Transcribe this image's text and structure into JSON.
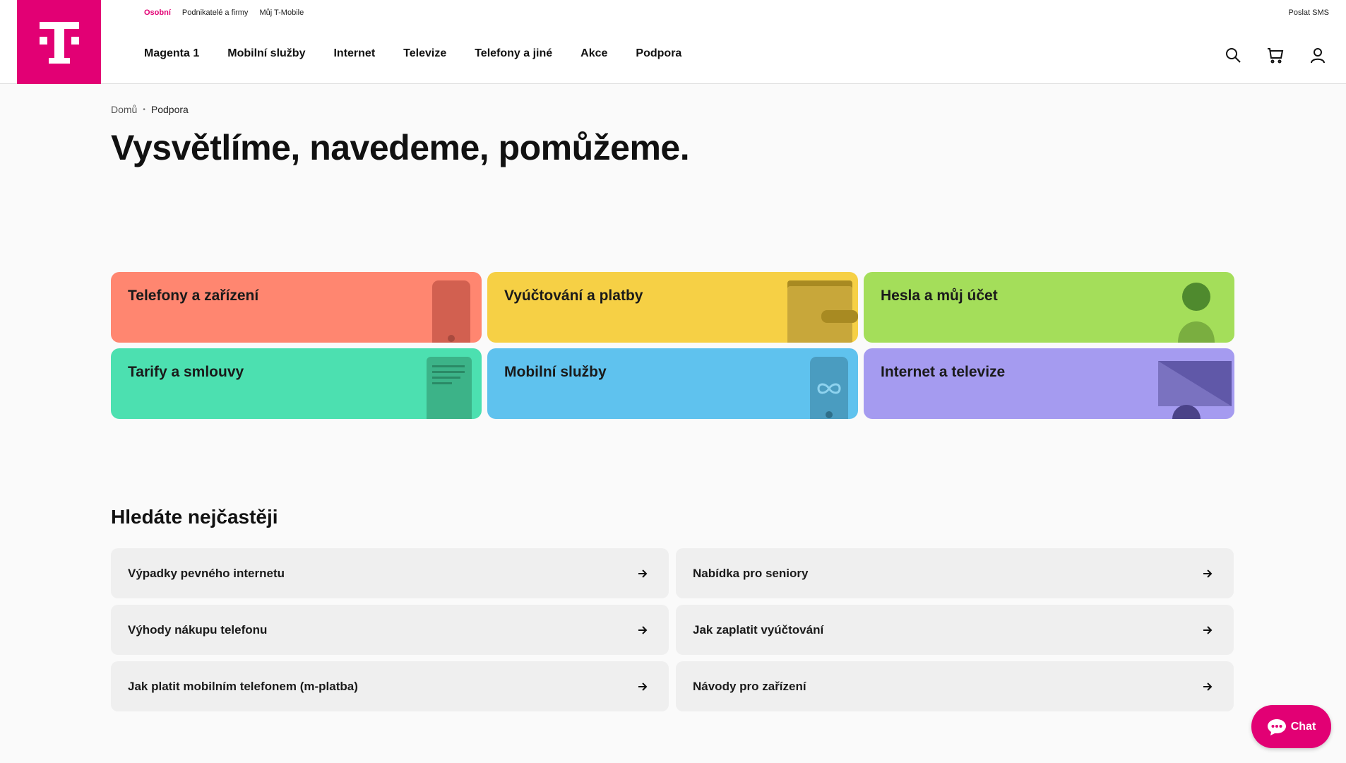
{
  "colors": {
    "brand": "#e20074",
    "tile_phones": "#ff8670",
    "tile_billing": "#f6d045",
    "tile_account": "#a4de5a",
    "tile_tariffs": "#4ce0b0",
    "tile_mobile": "#5fc2ee",
    "tile_internet": "#a59bf0"
  },
  "header": {
    "top_links": [
      "Osobní",
      "Podnikatelé a firmy",
      "Můj T-Mobile"
    ],
    "send_sms": "Poslat SMS",
    "nav": [
      "Magenta 1",
      "Mobilní služby",
      "Internet",
      "Televize",
      "Telefony a jiné",
      "Akce",
      "Podpora"
    ],
    "icons": [
      "search-icon",
      "cart-icon",
      "user-icon"
    ]
  },
  "breadcrumb": {
    "home": "Domů",
    "current": "Podpora"
  },
  "page_title": "Vysvětlíme, navedeme, pomůžeme.",
  "tiles": [
    {
      "label": "Telefony a zařízení",
      "icon": "phone-icon"
    },
    {
      "label": "Vyúčtování a platby",
      "icon": "wallet-icon"
    },
    {
      "label": "Hesla a můj účet",
      "icon": "person-icon"
    },
    {
      "label": "Tarify a smlouvy",
      "icon": "document-icon"
    },
    {
      "label": "Mobilní služby",
      "icon": "mobile-infinity-icon"
    },
    {
      "label": "Internet a televize",
      "icon": "screen-icon"
    }
  ],
  "faq": {
    "title": "Hledáte nejčastěji",
    "items": [
      "Výpadky pevného internetu",
      "Nabídka pro seniory",
      "Výhody nákupu telefonu",
      "Jak zaplatit vyúčtování",
      "Jak platit mobilním telefonem (m-platba)",
      "Návody pro zařízení"
    ]
  },
  "chat": {
    "label": "Chat",
    "icon": "chat-bubble-icon"
  }
}
